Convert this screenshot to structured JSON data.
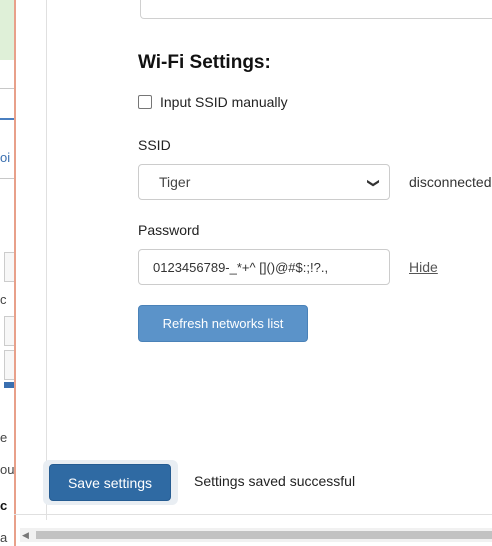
{
  "background": {
    "fragments": [
      "oi",
      "c",
      "e",
      "ou",
      "c",
      "a"
    ]
  },
  "wifi": {
    "heading": "Wi-Fi Settings:",
    "manual_ssid_label": "Input SSID manually",
    "manual_ssid_checked": false,
    "ssid_label": "SSID",
    "ssid_value": "Tiger",
    "status": "disconnected",
    "password_label": "Password",
    "password_value": "0123456789-_*+^ []()@#$:;!?.,",
    "hide_label": "Hide",
    "refresh_label": "Refresh networks list"
  },
  "footer": {
    "save_label": "Save settings",
    "saved_message": "Settings saved successful"
  },
  "colors": {
    "primary": "#2f6aa3",
    "secondary": "#5b93c9",
    "panel_border": "#e8a08a"
  }
}
